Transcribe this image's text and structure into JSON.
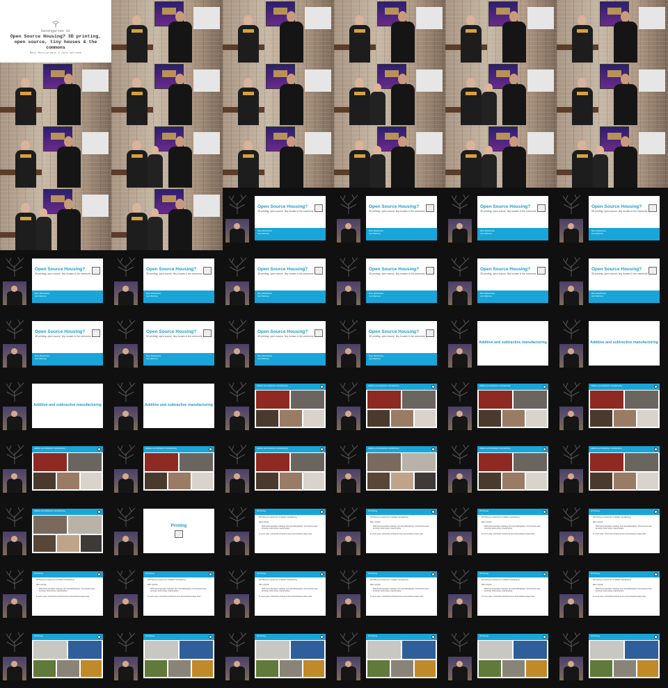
{
  "title_card": {
    "kicker": "Datengarten 92",
    "title": "Open Source Housing? 3D printing, open source, tiny houses & the commons",
    "speakers": "Maxy Meisterhaus & Jens Welcome"
  },
  "slides": {
    "intro": {
      "title": "Open Source Housing?",
      "subtitle": "3D printing, open source, tiny houses & the commons",
      "meta": [
        "Maxy Meisterhaus",
        "Jens Welcome"
      ]
    },
    "manufacturing": {
      "title": "Additive and subtractive manufacturing"
    },
    "manufacturing_photos": {
      "header": "Additive and subtractive manufacturing"
    },
    "printing_section": {
      "title": "Printing"
    },
    "printing_text": {
      "header": "3D Printing",
      "bullets": [
        "3D Printing is a subset form of additive manufacturing.",
        "Main methods:",
        "FDM (fused deposition modeling), SLA (stereolithography), SLS (selective laser sintering), binder jetting, material jetting",
        "In recent years, construction printing has been demonstrated at large scale"
      ]
    },
    "printing_photos": {
      "header": "3D Printing"
    }
  },
  "colors": {
    "slide_band": "#19a5d8",
    "slide_title": "#1a9ccc",
    "background": "#111111"
  },
  "frames": [
    "title",
    "cam",
    "cam",
    "cam",
    "cam",
    "cam",
    "cam",
    "cam",
    "cam",
    "cam3",
    "cam3",
    "cam",
    "cam",
    "cam3",
    "cam",
    "cam3",
    "cam3",
    "cam3",
    "cam3",
    "cam3",
    "intro",
    "intro",
    "intro",
    "intro",
    "intro",
    "intro",
    "intro",
    "intro",
    "intro",
    "intro",
    "intro",
    "intro",
    "intro",
    "intro",
    "manu",
    "manu",
    "manu",
    "manu",
    "manuphoto",
    "manuphoto",
    "manuphoto",
    "manuphoto",
    "manuphoto",
    "manuphoto",
    "manuphoto",
    "manuphoto2",
    "manuphoto",
    "manuphoto",
    "manuphoto2",
    "printing",
    "printtext",
    "printtext",
    "printtext",
    "printtext",
    "printtext",
    "printtext",
    "printtext",
    "printtext",
    "printtext",
    "printtext",
    "printphoto",
    "printphoto",
    "printphoto",
    "printphoto",
    "printphoto",
    "printphoto"
  ]
}
